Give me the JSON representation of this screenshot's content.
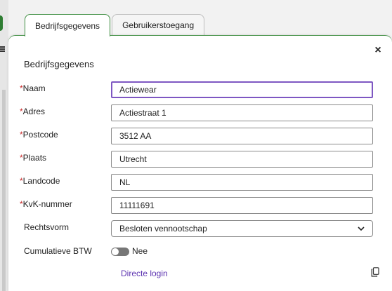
{
  "tabs": [
    {
      "label": "Bedrijfsgegevens",
      "active": true
    },
    {
      "label": "Gebruikerstoegang",
      "active": false
    }
  ],
  "panel": {
    "title": "Bedrijfsgegevens",
    "close_symbol": "×"
  },
  "form": {
    "naam": {
      "label": "Naam",
      "value": "Actiewear",
      "required": true
    },
    "adres": {
      "label": "Adres",
      "value": "Actiestraat 1",
      "required": true
    },
    "postcode": {
      "label": "Postcode",
      "value": "3512 AA",
      "required": true
    },
    "plaats": {
      "label": "Plaats",
      "value": "Utrecht",
      "required": true
    },
    "landcode": {
      "label": "Landcode",
      "value": "NL",
      "required": true
    },
    "kvk": {
      "label": "KvK-nummer",
      "value": "11111691",
      "required": true
    },
    "rechtsvorm": {
      "label": "Rechtsvorm",
      "value": "Besloten vennootschap"
    },
    "btw": {
      "label": "Cumulatieve BTW",
      "toggle_text": "Nee",
      "on": false
    }
  },
  "required_marker": "*",
  "link": {
    "label": "Directe login"
  },
  "colors": {
    "accent_green": "#3e8e41",
    "focus_purple": "#7e57c2",
    "link_purple": "#5e35b1",
    "required_red": "#c62828"
  },
  "icons": {
    "close": "close-icon",
    "chevron": "chevron-down-icon",
    "copy": "copy-icon",
    "menu": "menu-icon"
  }
}
